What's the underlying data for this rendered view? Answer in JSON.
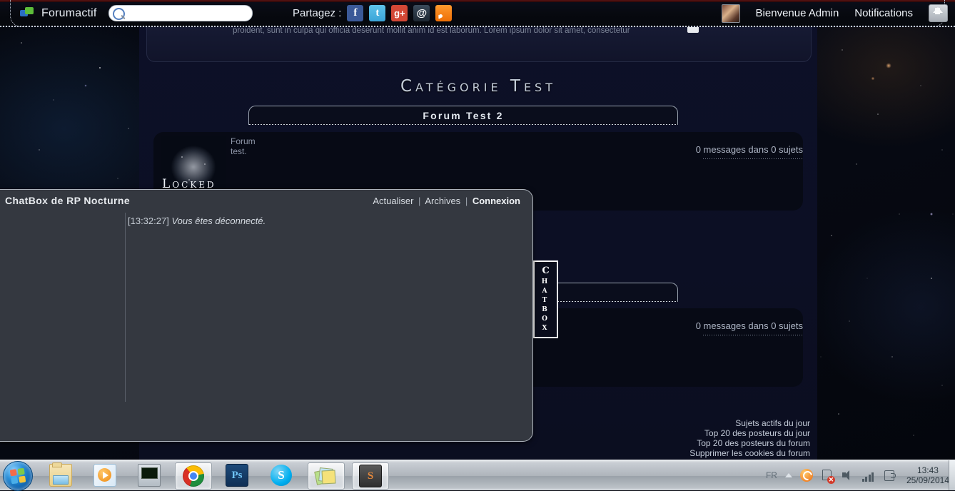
{
  "toolbar": {
    "brand": "Forumactif",
    "search_value": "",
    "search_placeholder": "",
    "share_label": "Partagez :",
    "social": [
      {
        "name": "facebook-icon",
        "glyph": "f"
      },
      {
        "name": "twitter-icon",
        "glyph": "t"
      },
      {
        "name": "googleplus-icon",
        "glyph": "g+"
      },
      {
        "name": "email-icon",
        "glyph": "@"
      },
      {
        "name": "rss-icon",
        "glyph": ""
      }
    ],
    "welcome": "Bienvenue Admin",
    "notifications": "Notifications",
    "collapse_icon": "up-arrow-icon"
  },
  "announcement": {
    "text": "proident, sunt in culpa qui officia deserunt mollit anim id est laborum. Lorem ipsum dolor sit amet, consectetur"
  },
  "category": {
    "title": "Catégorie Test"
  },
  "forums": [
    {
      "title": "Forum Test 2",
      "description": "Forum test.",
      "stats": "0 messages dans 0 sujets",
      "badge": "Locked"
    },
    {
      "title": "",
      "description": "",
      "stats": "0 messages dans 0 sujets",
      "badge": ""
    }
  ],
  "footer_links": [
    "Sujets actifs du jour",
    "Top 20 des posteurs du jour",
    "Top 20 des posteurs du forum",
    "Supprimer les cookies du forum"
  ],
  "chatbox_tab": {
    "label": "Chatbox"
  },
  "chatbox": {
    "title": "ChatBox de RP Nocturne",
    "link_refresh": "Actualiser",
    "link_archives": "Archives",
    "link_login": "Connexion",
    "sep": "|",
    "message_timestamp": "[13:32:27]",
    "message_body": "Vous êtes déconnecté."
  },
  "taskbar": {
    "start": "start-orb",
    "items": [
      {
        "name": "taskbar-explorer",
        "label": "Explorateur Windows",
        "active": false
      },
      {
        "name": "taskbar-media-player",
        "label": "Windows Media Player",
        "active": false
      },
      {
        "name": "taskbar-monitor",
        "label": "Moniteur",
        "active": false
      },
      {
        "name": "taskbar-chrome",
        "label": "Google Chrome",
        "active": true
      },
      {
        "name": "taskbar-photoshop",
        "label": "Ps",
        "active": false
      },
      {
        "name": "taskbar-skype",
        "label": "S",
        "active": false
      },
      {
        "name": "taskbar-notes",
        "label": "Notes",
        "active": true
      },
      {
        "name": "taskbar-sublime",
        "label": "S",
        "active": true
      }
    ],
    "tray": {
      "language": "FR",
      "time": "13:43",
      "date": "25/09/2014",
      "icons": [
        "show-hidden-icons",
        "updater-icon",
        "action-center-flag-icon",
        "volume-icon",
        "network-icon",
        "safely-remove-icon"
      ]
    }
  },
  "colors": {
    "chatbox_bg": "#343840",
    "forum_bg": "#0b0e20",
    "accent_border": "#aeb4bd",
    "taskbar": "#aeb4bb"
  }
}
